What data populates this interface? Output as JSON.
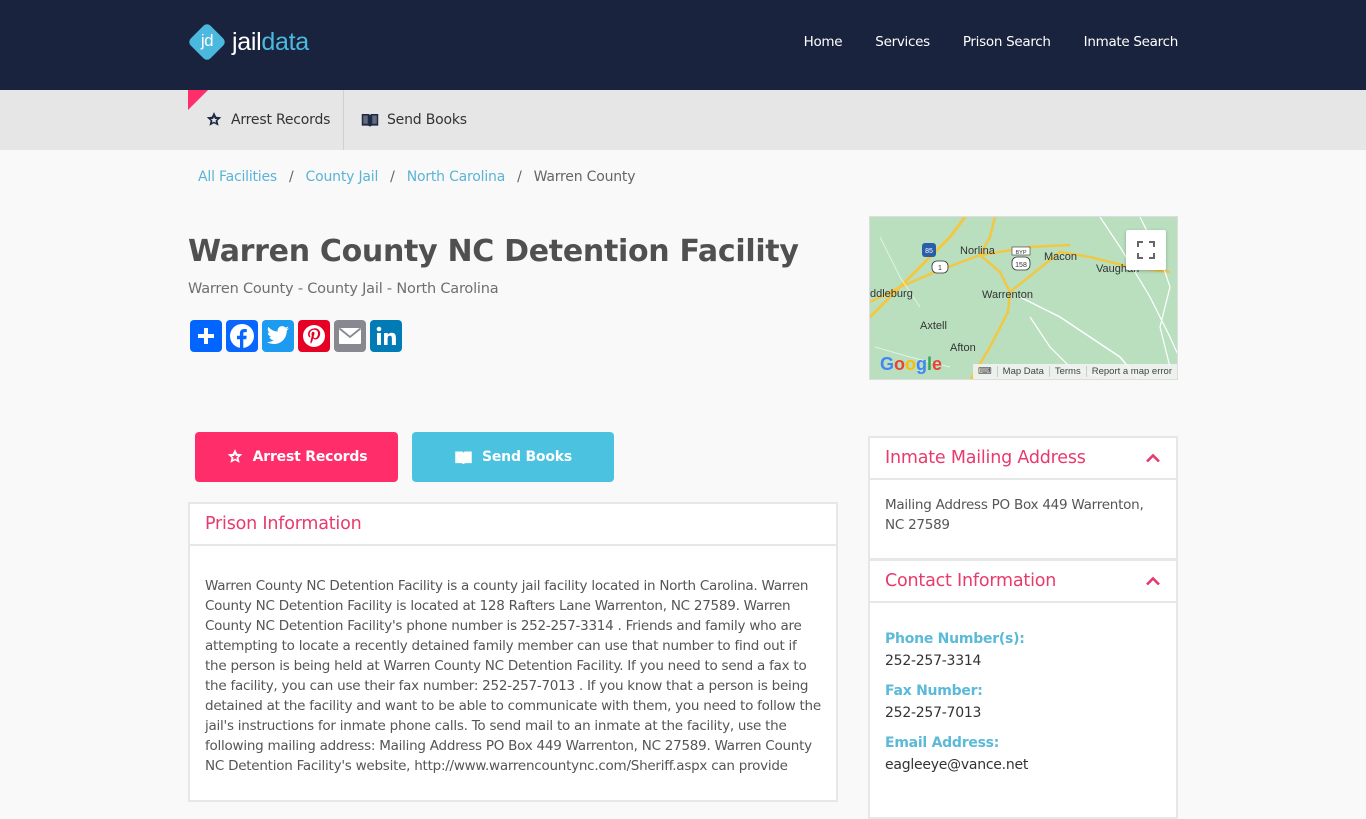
{
  "header": {
    "logo_mark": "jd",
    "logo_word_1": "jail",
    "logo_word_2": "data",
    "nav": [
      "Home",
      "Services",
      "Prison Search",
      "Inmate Search"
    ]
  },
  "subbar": {
    "items": [
      {
        "label": "Arrest Records",
        "icon": "sheriff-star-icon"
      },
      {
        "label": "Send Books",
        "icon": "open-book-icon"
      }
    ]
  },
  "breadcrumb": {
    "links": [
      "All Facilities",
      "County Jail",
      "North Carolina"
    ],
    "separator": "/",
    "current": "Warren County"
  },
  "page": {
    "title": "Warren County NC Detention Facility",
    "subtitle": "Warren County - County Jail - North Carolina"
  },
  "share": [
    {
      "name": "share-add",
      "icon": "plus-icon",
      "color": "#0166ff"
    },
    {
      "name": "facebook",
      "icon": "facebook-icon",
      "color": "#0866ff"
    },
    {
      "name": "twitter",
      "icon": "twitter-icon",
      "color": "#1d9bf0"
    },
    {
      "name": "pinterest",
      "icon": "pinterest-icon",
      "color": "#e60023"
    },
    {
      "name": "email",
      "icon": "email-icon",
      "color": "#888990"
    },
    {
      "name": "linkedin",
      "icon": "linkedin-icon",
      "color": "#007bb5"
    }
  ],
  "map": {
    "labels": [
      "Norlina",
      "Macon",
      "Vaughan",
      "ddleburg",
      "Warrenton",
      "Axtell",
      "Afton"
    ],
    "shields": [
      "85",
      "1",
      "BYP",
      "158"
    ],
    "attribution": "Google",
    "footer": [
      "Map Data",
      "Terms",
      "Report a map error"
    ]
  },
  "actions": {
    "arrest_records": "Arrest Records",
    "send_books": "Send Books"
  },
  "prison_info": {
    "heading": "Prison Information",
    "body": "Warren County NC Detention Facility is a county jail facility located in North Carolina. Warren County NC Detention Facility is located at 128 Rafters Lane Warrenton, NC 27589. Warren County NC Detention Facility's phone number is 252-257-3314 . Friends and family who are attempting to locate a recently detained family member can use that number to find out if the person is being held at Warren County NC Detention Facility. If you need to send a fax to the facility, you can use their fax number: 252-257-7013 . If you know that a person is being detained at the facility and want to be able to communicate with them, you need to follow the jail's instructions for inmate phone calls. To send mail to an inmate at the facility, use the following mailing address: Mailing Address PO Box 449 Warrenton, NC 27589. Warren County NC Detention Facility's website, http://www.warrencountync.com/Sheriff.aspx can provide"
  },
  "mailing": {
    "heading": "Inmate Mailing Address",
    "address": "Mailing Address PO Box 449 Warrenton, NC 27589"
  },
  "contact": {
    "heading": "Contact Information",
    "phone_label": "Phone Number(s):",
    "phone": "252-257-3314",
    "fax_label": "Fax Number:",
    "fax": "252-257-7013",
    "email_label": "Email Address:",
    "email": "eagleeye@vance.net"
  },
  "colors": {
    "navy": "#19233d",
    "accent_pink": "#ff2d6a",
    "accent_blue": "#4bc2e0",
    "heading_pink": "#e83a6b",
    "link_blue": "#5bb4d6"
  }
}
